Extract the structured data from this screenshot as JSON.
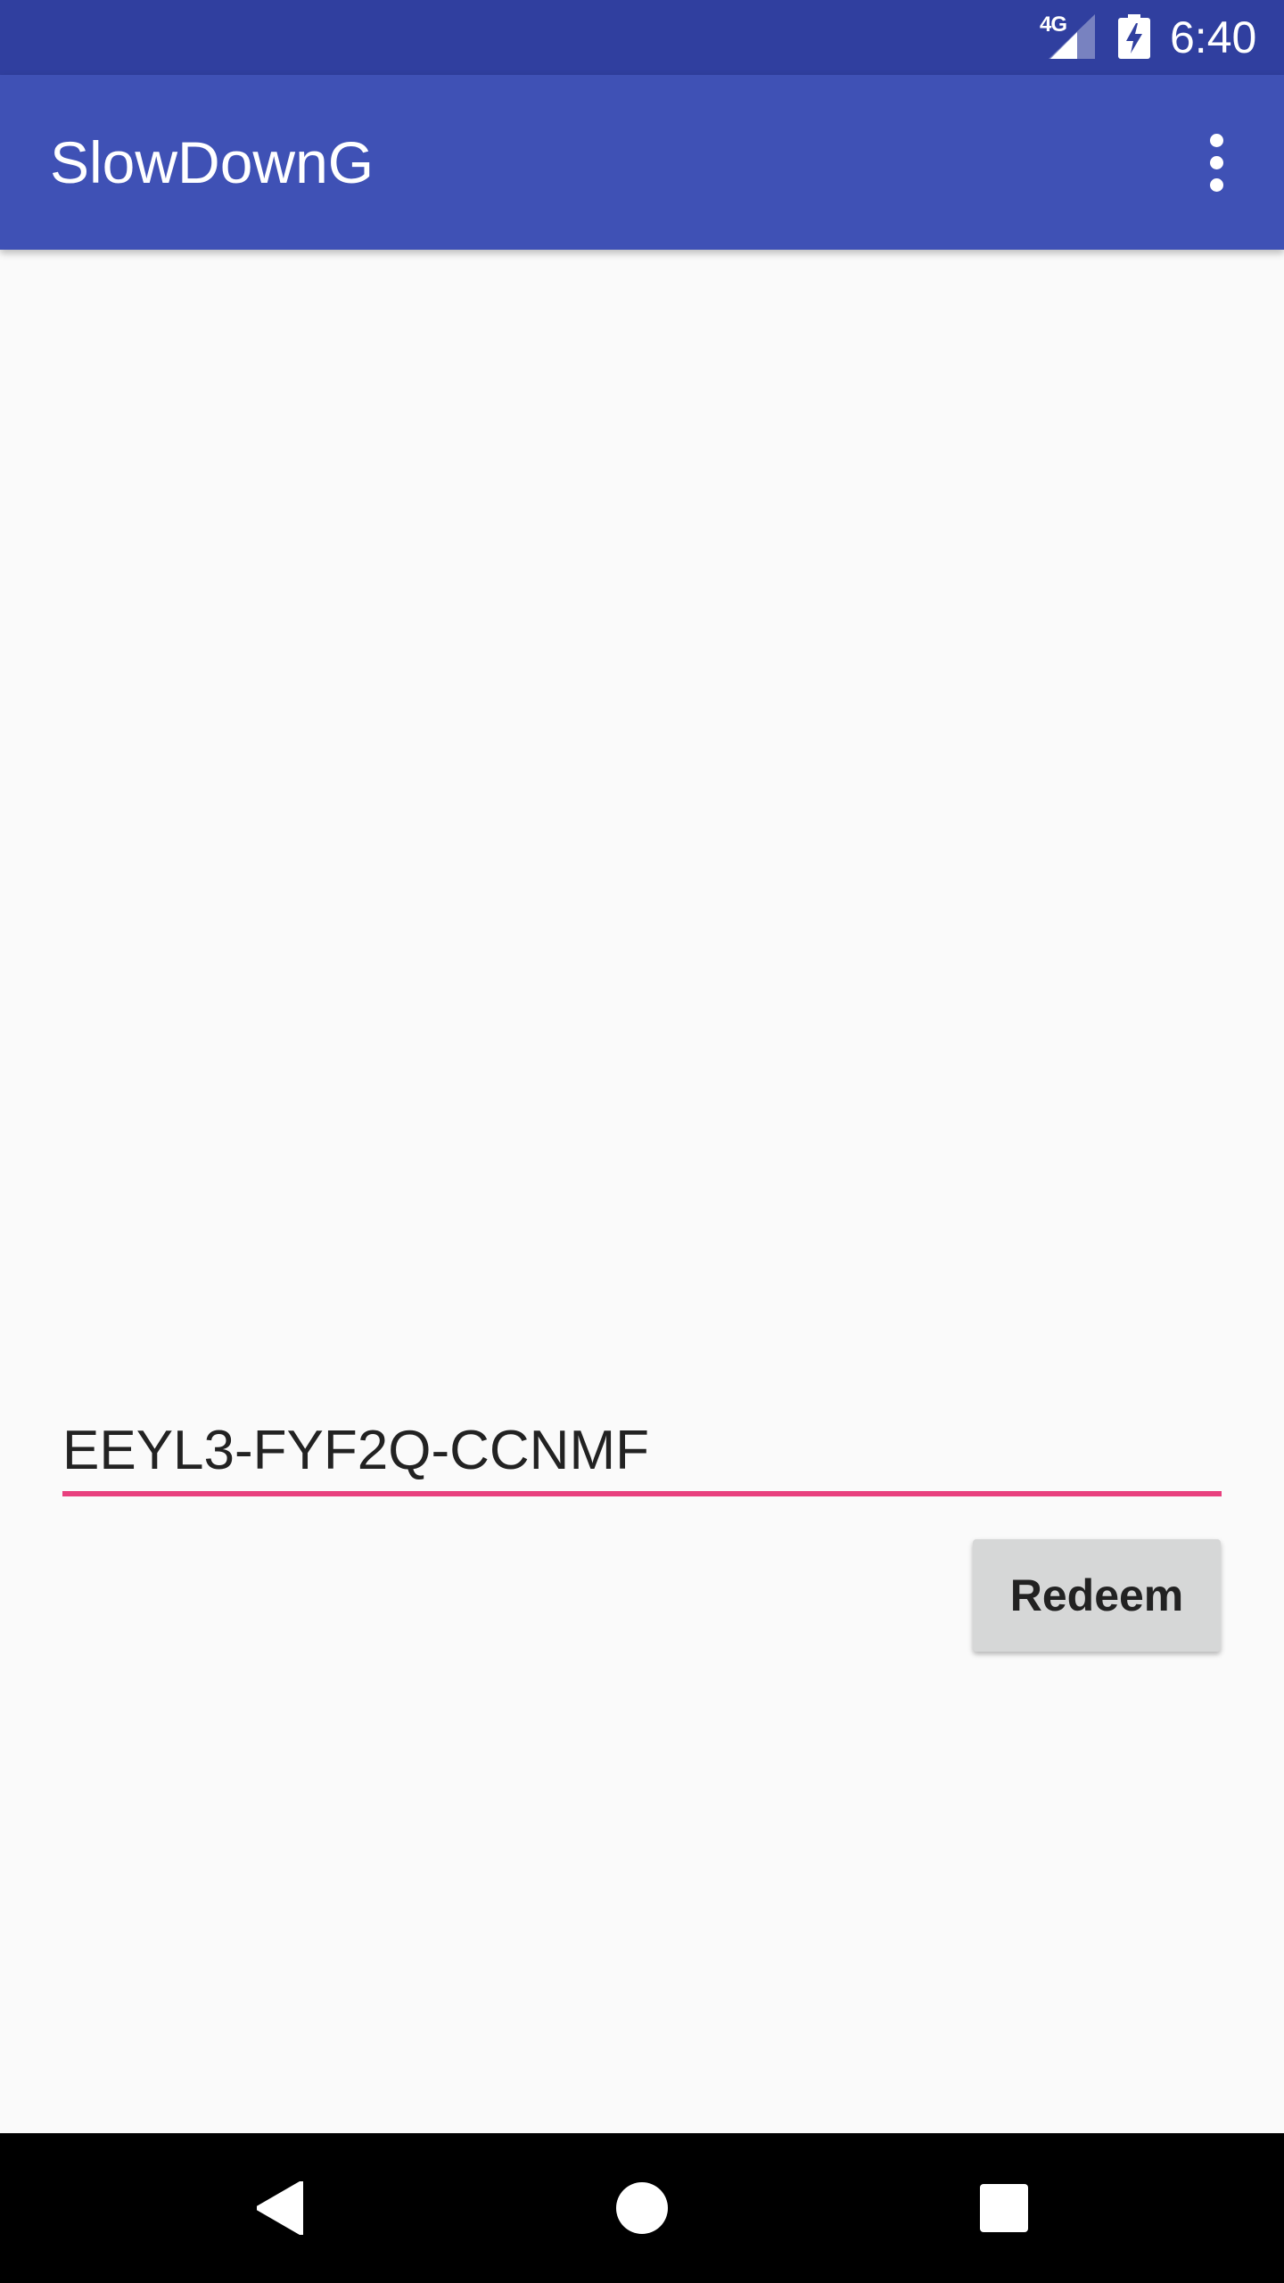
{
  "status_bar": {
    "network": "4G",
    "time": "6:40",
    "icons": [
      "signal-icon",
      "battery-charging-icon"
    ],
    "background_color": "#303f9f"
  },
  "app_bar": {
    "title": "SlowDownG",
    "overflow_icon": "more-vert-icon",
    "background_color": "#3f51b5"
  },
  "form": {
    "code_value": "EEYL3-FYF2Q-CCNMF",
    "underline_color": "#e8407e",
    "redeem_label": "Redeem"
  },
  "nav_bar": {
    "icons": [
      "back-icon",
      "home-icon",
      "recents-icon"
    ]
  }
}
